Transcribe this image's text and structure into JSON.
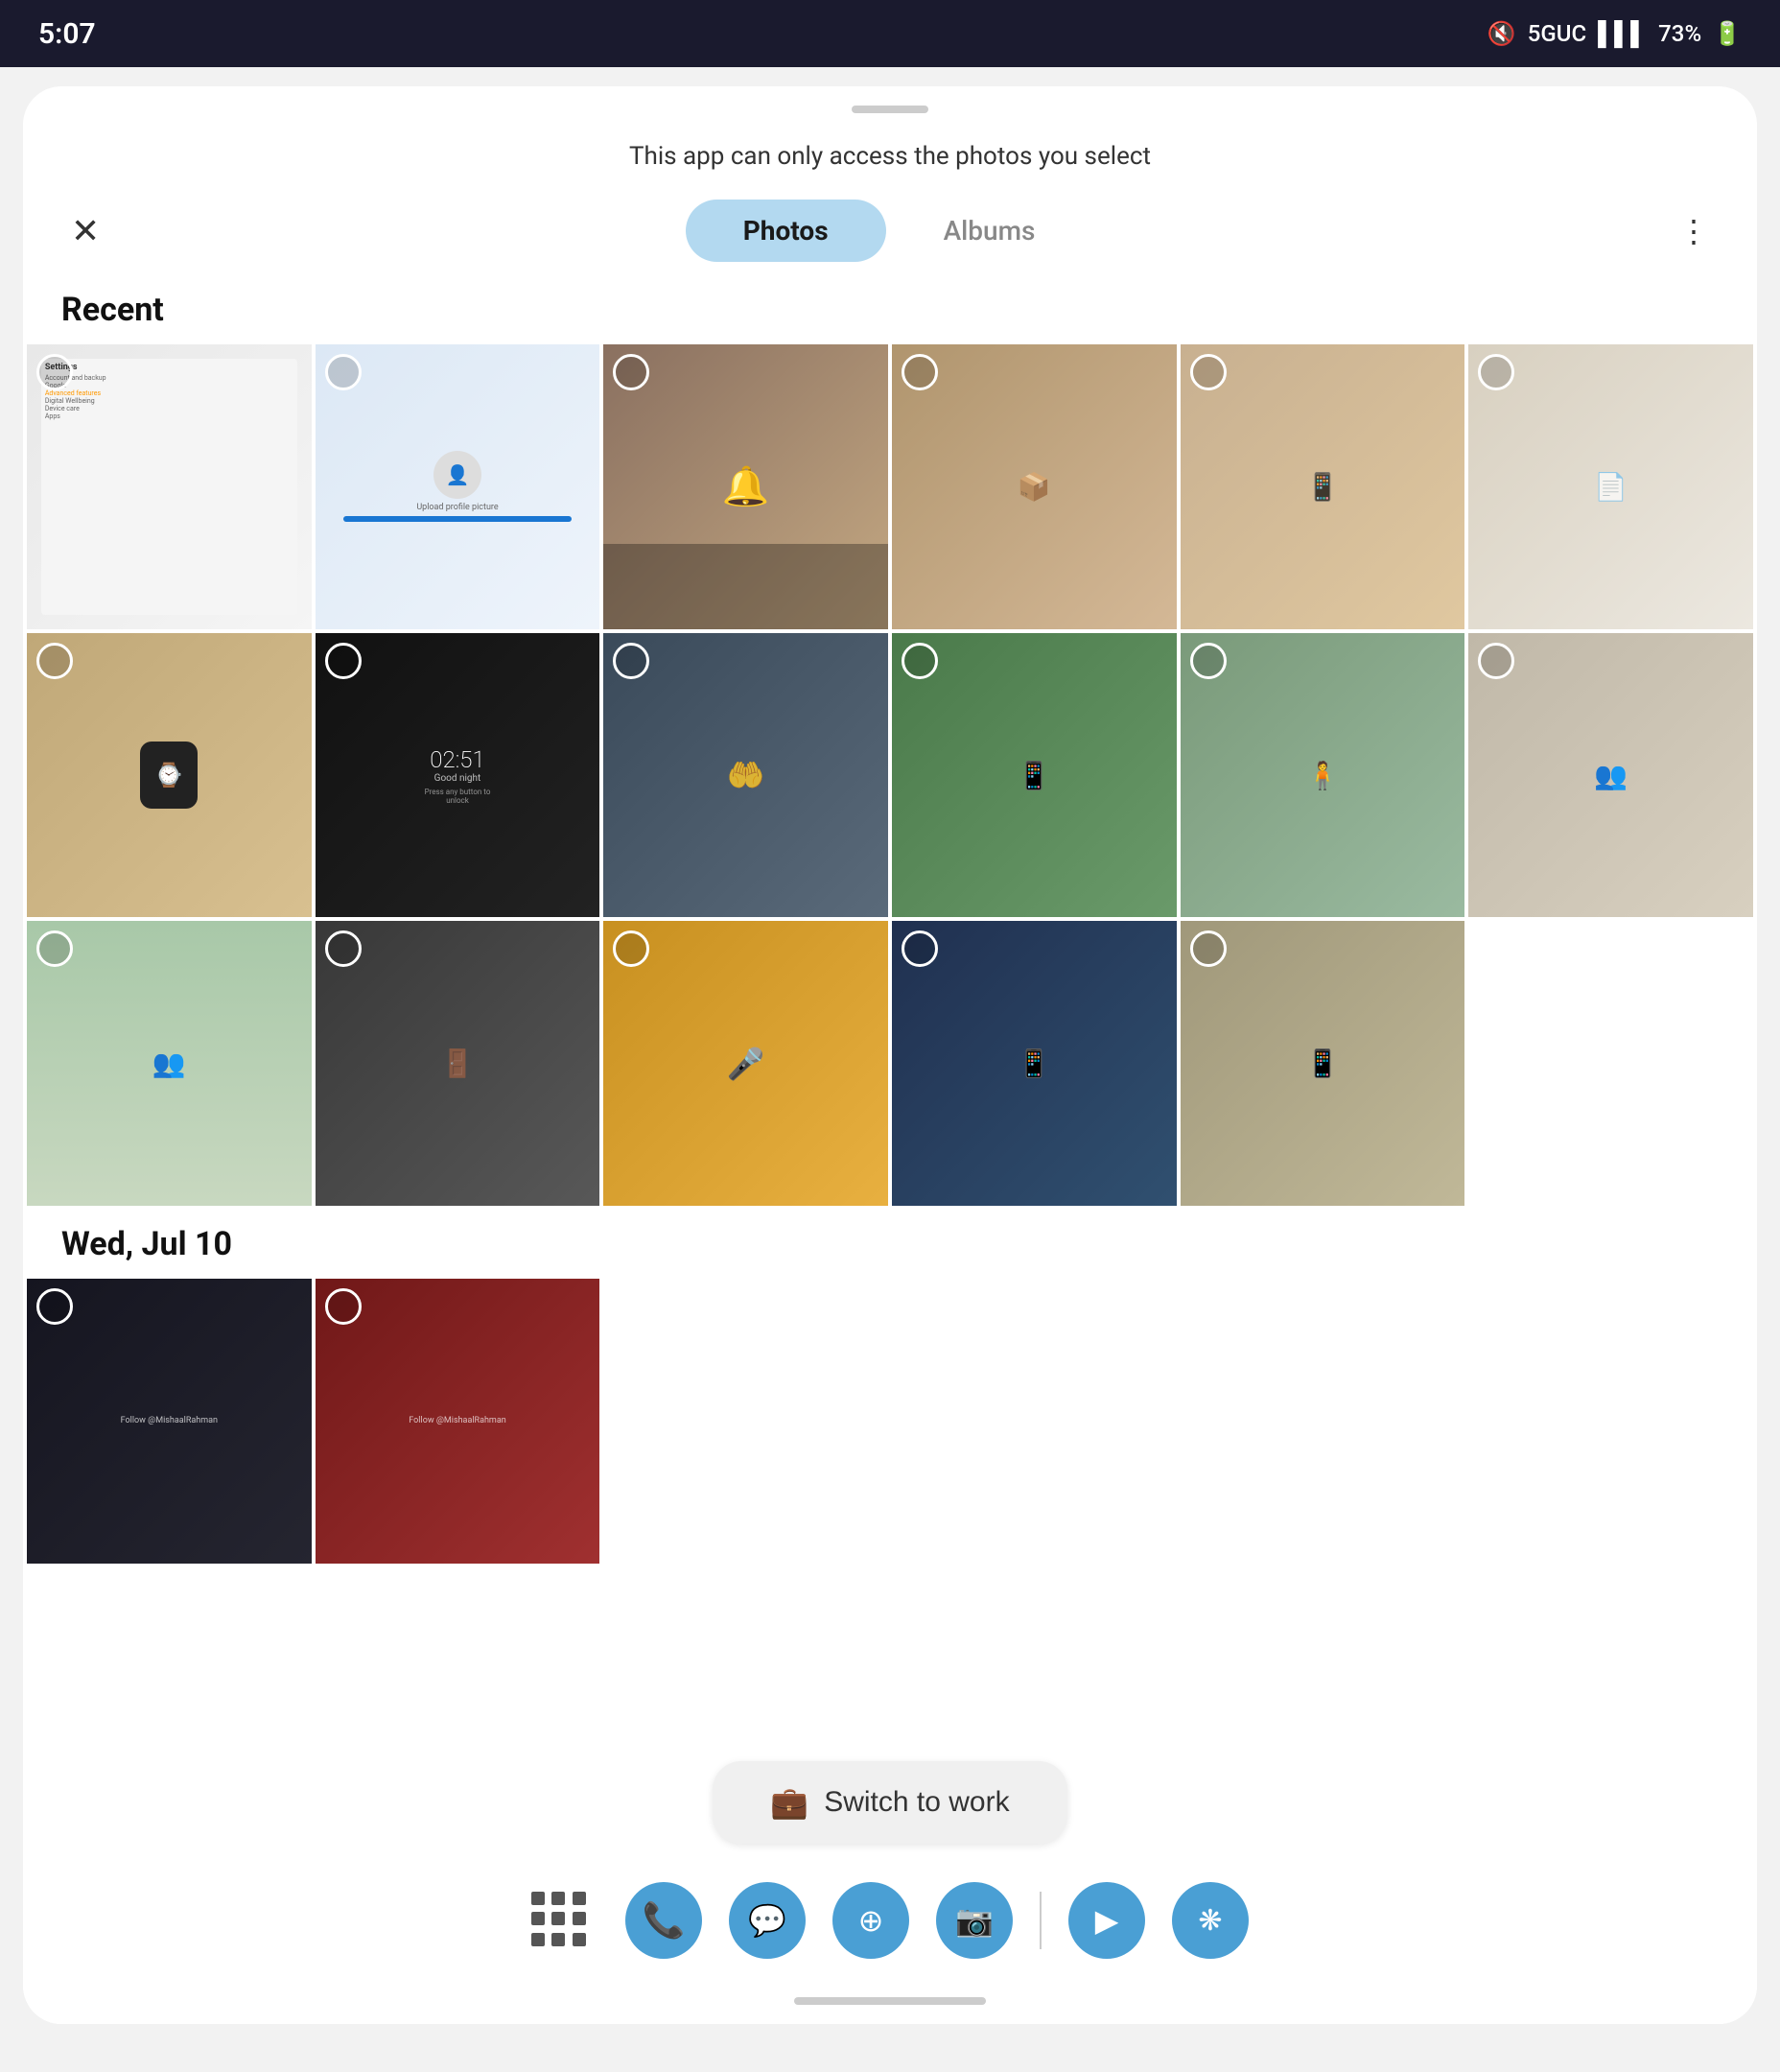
{
  "statusBar": {
    "time": "5:07",
    "signal": "5GUC",
    "bars": "▌▌▌",
    "battery": "73%",
    "muteIcon": "🔇"
  },
  "header": {
    "permissionNotice": "This app can only access the photos you select",
    "tabs": [
      {
        "id": "photos",
        "label": "Photos",
        "active": true
      },
      {
        "id": "albums",
        "label": "Albums",
        "active": false
      }
    ],
    "moreMenuLabel": "⋮"
  },
  "sections": [
    {
      "id": "recent",
      "label": "Recent",
      "photos": [
        {
          "id": "p1",
          "color": "settings",
          "desc": "Settings screenshot"
        },
        {
          "id": "p2",
          "color": "profile",
          "desc": "Profile picture upload"
        },
        {
          "id": "p3",
          "color": "doorbell",
          "desc": "Doorbell camera"
        },
        {
          "id": "p4",
          "color": "box1",
          "desc": "Box product"
        },
        {
          "id": "p5",
          "color": "device1",
          "desc": "Device in box"
        },
        {
          "id": "p6",
          "color": "doc1",
          "desc": "Document"
        },
        {
          "id": "p7",
          "color": "watch",
          "desc": "Pixel Watch"
        },
        {
          "id": "p8",
          "color": "screen",
          "desc": "Lockscreen 02:51"
        },
        {
          "id": "p9",
          "color": "glass",
          "desc": "Glass hand"
        },
        {
          "id": "p10",
          "color": "hand",
          "desc": "Phone in hand outdoors"
        },
        {
          "id": "p11",
          "color": "street",
          "desc": "Person on street"
        },
        {
          "id": "p12",
          "color": "people1",
          "desc": "People in store"
        },
        {
          "id": "p13",
          "color": "group1",
          "desc": "Group in store"
        },
        {
          "id": "p14",
          "color": "curtain",
          "desc": "Curtain hallway"
        },
        {
          "id": "p15",
          "color": "mic",
          "desc": "Microphone setup"
        },
        {
          "id": "p16",
          "color": "flip1",
          "desc": "Flip phone open"
        },
        {
          "id": "p17",
          "color": "flip2",
          "desc": "Phone on stand"
        }
      ]
    },
    {
      "id": "wed-jul-10",
      "label": "Wed, Jul 10",
      "photos": [
        {
          "id": "p18",
          "color": "phone1",
          "desc": "Phone with text"
        },
        {
          "id": "p19",
          "color": "phones",
          "desc": "Multiple phones"
        }
      ]
    }
  ],
  "switchToWork": {
    "label": "Switch to work",
    "icon": "briefcase"
  },
  "dock": {
    "gridIcon": "grid",
    "apps": [
      {
        "id": "phone",
        "label": "Phone",
        "color": "#4a9fd4",
        "icon": "📞"
      },
      {
        "id": "messages",
        "label": "Messages",
        "color": "#4a9fd4",
        "icon": "💬"
      },
      {
        "id": "chrome",
        "label": "Chrome",
        "color": "#4a9fd4",
        "icon": "⊕"
      },
      {
        "id": "camera",
        "label": "Camera",
        "color": "#4a9fd4",
        "icon": "📷"
      },
      {
        "id": "play",
        "label": "Play Store",
        "color": "#4a9fd4",
        "icon": "▶"
      },
      {
        "id": "petal",
        "label": "Petal",
        "color": "#4a9fd4",
        "icon": "❋"
      }
    ]
  }
}
